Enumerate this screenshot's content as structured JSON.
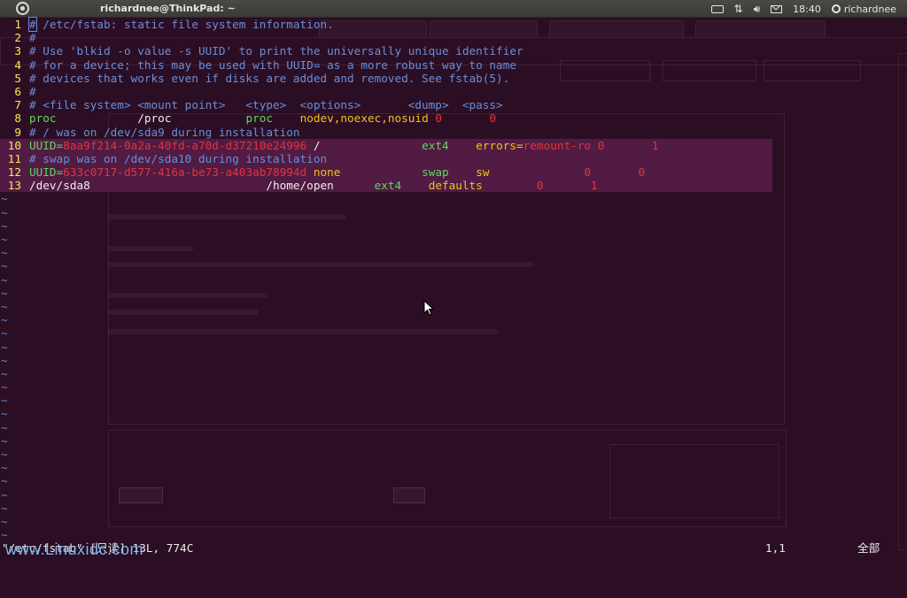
{
  "panel": {
    "window_title": "richardnee@ThinkPad: ~",
    "clock": "18:40",
    "user": "richardnee"
  },
  "editor": {
    "lines": [
      {
        "n": "1",
        "segments": [
          {
            "t": "#",
            "c": "cursor"
          },
          {
            "t": " /etc/fstab: static file system information.",
            "c": "cm"
          }
        ]
      },
      {
        "n": "2",
        "segments": [
          {
            "t": "#",
            "c": "cm"
          }
        ]
      },
      {
        "n": "3",
        "segments": [
          {
            "t": "# Use 'blkid -o value -s UUID' to print the universally unique identifier",
            "c": "cm"
          }
        ]
      },
      {
        "n": "4",
        "segments": [
          {
            "t": "# for a device; this may be used with UUID= as a more robust way to name",
            "c": "cm"
          }
        ]
      },
      {
        "n": "5",
        "segments": [
          {
            "t": "# devices that works even if disks are added and removed. See fstab(5).",
            "c": "cm"
          }
        ]
      },
      {
        "n": "6",
        "segments": [
          {
            "t": "#",
            "c": "cm"
          }
        ]
      },
      {
        "n": "7",
        "segments": [
          {
            "t": "# <file system> <mount point>   <type>  <options>       <dump>  <pass>",
            "c": "cm"
          }
        ]
      },
      {
        "n": "8",
        "segments": [
          {
            "t": "proc",
            "c": "kw"
          },
          {
            "t": "            /proc           ",
            "c": "wt"
          },
          {
            "t": "proc",
            "c": "kw"
          },
          {
            "t": "    ",
            "c": "wt"
          },
          {
            "t": "nodev,noexec,nosuid",
            "c": "yw"
          },
          {
            "t": " ",
            "c": "wt"
          },
          {
            "t": "0",
            "c": "rd"
          },
          {
            "t": "       ",
            "c": "wt"
          },
          {
            "t": "0",
            "c": "rd"
          }
        ]
      },
      {
        "n": "9",
        "segments": [
          {
            "t": "# / was on /dev/sda9 during installation",
            "c": "cm"
          }
        ]
      },
      {
        "n": "10",
        "hl": true,
        "segments": [
          {
            "t": "UUID=",
            "c": "kw"
          },
          {
            "t": "8aa9f214-0a2a-40fd-a70d-d37210e24996",
            "c": "rd"
          },
          {
            "t": " /               ",
            "c": "wt"
          },
          {
            "t": "ext4",
            "c": "kw"
          },
          {
            "t": "    errors=",
            "c": "yw"
          },
          {
            "t": "remount-ro",
            "c": "rd"
          },
          {
            "t": " ",
            "c": "wt"
          },
          {
            "t": "0",
            "c": "rd"
          },
          {
            "t": "       ",
            "c": "wt"
          },
          {
            "t": "1",
            "c": "rd"
          }
        ]
      },
      {
        "n": "11",
        "hl": true,
        "segments": [
          {
            "t": "# swap was on /dev/sda10 during installation",
            "c": "cm"
          }
        ]
      },
      {
        "n": "12",
        "hl": true,
        "segments": [
          {
            "t": "UUID=",
            "c": "kw"
          },
          {
            "t": "633c0717-d577-416a-be73-a403ab78994d",
            "c": "rd"
          },
          {
            "t": " ",
            "c": "wt"
          },
          {
            "t": "none",
            "c": "yw"
          },
          {
            "t": "            ",
            "c": "wt"
          },
          {
            "t": "swap",
            "c": "kw"
          },
          {
            "t": "    ",
            "c": "wt"
          },
          {
            "t": "sw",
            "c": "yw"
          },
          {
            "t": "              ",
            "c": "wt"
          },
          {
            "t": "0",
            "c": "rd"
          },
          {
            "t": "       ",
            "c": "wt"
          },
          {
            "t": "0",
            "c": "rd"
          }
        ]
      },
      {
        "n": "13",
        "hl": true,
        "segments": [
          {
            "t": "/dev/sda8",
            "c": "wt"
          },
          {
            "t": "                          /home/open      ",
            "c": "wt"
          },
          {
            "t": "ext4",
            "c": "kw"
          },
          {
            "t": "    ",
            "c": "wt"
          },
          {
            "t": "defaults",
            "c": "yw"
          },
          {
            "t": "        ",
            "c": "wt"
          },
          {
            "t": "0",
            "c": "rd"
          },
          {
            "t": "       ",
            "c": "wt"
          },
          {
            "t": "1",
            "c": "rd"
          }
        ]
      }
    ],
    "tilde_count": 26,
    "tilde_char": "~"
  },
  "status": {
    "file": "\"/etc/fstab\" [只读] 13L, 774C",
    "position": "1,1",
    "scroll": "全部"
  },
  "watermark": "www.Linuxidc.com",
  "colors": {
    "background": "#2c0e24",
    "comment": "#6a8ed8",
    "keyword": "#5fd75f",
    "number": "#e3343d",
    "option": "#f0c419",
    "line_number": "#fce94f",
    "highlight_row": "#511b43"
  }
}
